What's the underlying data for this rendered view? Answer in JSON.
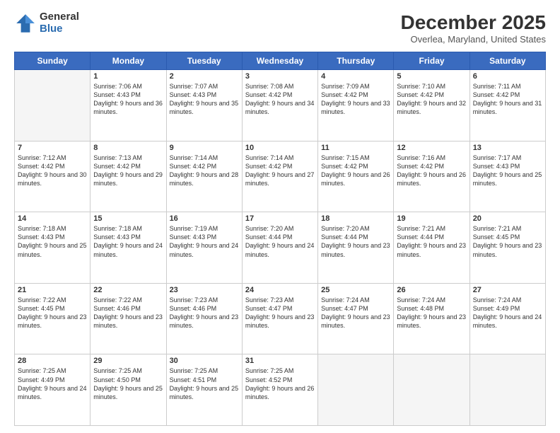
{
  "header": {
    "logo": {
      "general": "General",
      "blue": "Blue"
    },
    "title": "December 2025",
    "subtitle": "Overlea, Maryland, United States"
  },
  "days_of_week": [
    "Sunday",
    "Monday",
    "Tuesday",
    "Wednesday",
    "Thursday",
    "Friday",
    "Saturday"
  ],
  "weeks": [
    [
      {
        "day": "",
        "empty": true
      },
      {
        "day": "1",
        "sunrise": "7:06 AM",
        "sunset": "4:43 PM",
        "daylight": "9 hours and 36 minutes."
      },
      {
        "day": "2",
        "sunrise": "7:07 AM",
        "sunset": "4:43 PM",
        "daylight": "9 hours and 35 minutes."
      },
      {
        "day": "3",
        "sunrise": "7:08 AM",
        "sunset": "4:42 PM",
        "daylight": "9 hours and 34 minutes."
      },
      {
        "day": "4",
        "sunrise": "7:09 AM",
        "sunset": "4:42 PM",
        "daylight": "9 hours and 33 minutes."
      },
      {
        "day": "5",
        "sunrise": "7:10 AM",
        "sunset": "4:42 PM",
        "daylight": "9 hours and 32 minutes."
      },
      {
        "day": "6",
        "sunrise": "7:11 AM",
        "sunset": "4:42 PM",
        "daylight": "9 hours and 31 minutes."
      }
    ],
    [
      {
        "day": "7",
        "sunrise": "7:12 AM",
        "sunset": "4:42 PM",
        "daylight": "9 hours and 30 minutes."
      },
      {
        "day": "8",
        "sunrise": "7:13 AM",
        "sunset": "4:42 PM",
        "daylight": "9 hours and 29 minutes."
      },
      {
        "day": "9",
        "sunrise": "7:14 AM",
        "sunset": "4:42 PM",
        "daylight": "9 hours and 28 minutes."
      },
      {
        "day": "10",
        "sunrise": "7:14 AM",
        "sunset": "4:42 PM",
        "daylight": "9 hours and 27 minutes."
      },
      {
        "day": "11",
        "sunrise": "7:15 AM",
        "sunset": "4:42 PM",
        "daylight": "9 hours and 26 minutes."
      },
      {
        "day": "12",
        "sunrise": "7:16 AM",
        "sunset": "4:42 PM",
        "daylight": "9 hours and 26 minutes."
      },
      {
        "day": "13",
        "sunrise": "7:17 AM",
        "sunset": "4:43 PM",
        "daylight": "9 hours and 25 minutes."
      }
    ],
    [
      {
        "day": "14",
        "sunrise": "7:18 AM",
        "sunset": "4:43 PM",
        "daylight": "9 hours and 25 minutes."
      },
      {
        "day": "15",
        "sunrise": "7:18 AM",
        "sunset": "4:43 PM",
        "daylight": "9 hours and 24 minutes."
      },
      {
        "day": "16",
        "sunrise": "7:19 AM",
        "sunset": "4:43 PM",
        "daylight": "9 hours and 24 minutes."
      },
      {
        "day": "17",
        "sunrise": "7:20 AM",
        "sunset": "4:44 PM",
        "daylight": "9 hours and 24 minutes."
      },
      {
        "day": "18",
        "sunrise": "7:20 AM",
        "sunset": "4:44 PM",
        "daylight": "9 hours and 23 minutes."
      },
      {
        "day": "19",
        "sunrise": "7:21 AM",
        "sunset": "4:44 PM",
        "daylight": "9 hours and 23 minutes."
      },
      {
        "day": "20",
        "sunrise": "7:21 AM",
        "sunset": "4:45 PM",
        "daylight": "9 hours and 23 minutes."
      }
    ],
    [
      {
        "day": "21",
        "sunrise": "7:22 AM",
        "sunset": "4:45 PM",
        "daylight": "9 hours and 23 minutes."
      },
      {
        "day": "22",
        "sunrise": "7:22 AM",
        "sunset": "4:46 PM",
        "daylight": "9 hours and 23 minutes."
      },
      {
        "day": "23",
        "sunrise": "7:23 AM",
        "sunset": "4:46 PM",
        "daylight": "9 hours and 23 minutes."
      },
      {
        "day": "24",
        "sunrise": "7:23 AM",
        "sunset": "4:47 PM",
        "daylight": "9 hours and 23 minutes."
      },
      {
        "day": "25",
        "sunrise": "7:24 AM",
        "sunset": "4:47 PM",
        "daylight": "9 hours and 23 minutes."
      },
      {
        "day": "26",
        "sunrise": "7:24 AM",
        "sunset": "4:48 PM",
        "daylight": "9 hours and 23 minutes."
      },
      {
        "day": "27",
        "sunrise": "7:24 AM",
        "sunset": "4:49 PM",
        "daylight": "9 hours and 24 minutes."
      }
    ],
    [
      {
        "day": "28",
        "sunrise": "7:25 AM",
        "sunset": "4:49 PM",
        "daylight": "9 hours and 24 minutes."
      },
      {
        "day": "29",
        "sunrise": "7:25 AM",
        "sunset": "4:50 PM",
        "daylight": "9 hours and 25 minutes."
      },
      {
        "day": "30",
        "sunrise": "7:25 AM",
        "sunset": "4:51 PM",
        "daylight": "9 hours and 25 minutes."
      },
      {
        "day": "31",
        "sunrise": "7:25 AM",
        "sunset": "4:52 PM",
        "daylight": "9 hours and 26 minutes."
      },
      {
        "day": "",
        "empty": true
      },
      {
        "day": "",
        "empty": true
      },
      {
        "day": "",
        "empty": true
      }
    ]
  ],
  "labels": {
    "sunrise_label": "Sunrise:",
    "sunset_label": "Sunset:",
    "daylight_label": "Daylight:"
  }
}
